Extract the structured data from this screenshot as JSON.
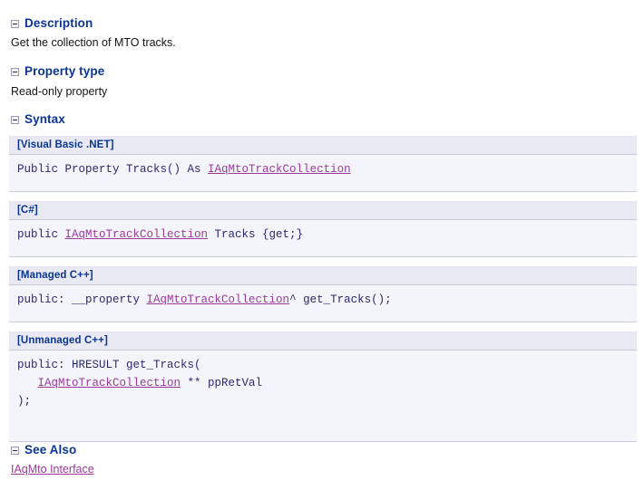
{
  "sections": {
    "description": {
      "heading": "Description",
      "toggle_icon": "collapse-minus-icon",
      "text": "Get the collection of MTO tracks."
    },
    "property_type": {
      "heading": "Property type",
      "toggle_icon": "collapse-minus-icon",
      "text": "Read-only property"
    },
    "syntax": {
      "heading": "Syntax",
      "toggle_icon": "collapse-minus-icon",
      "blocks": [
        {
          "language": "[Visual Basic .NET]",
          "code_before": "Public Property Tracks() As ",
          "link": "IAqMtoTrackCollection",
          "code_after": ""
        },
        {
          "language": "[C#]",
          "code_before": "public ",
          "link": "IAqMtoTrackCollection",
          "code_after": " Tracks {get;}"
        },
        {
          "language": "[Managed C++]",
          "code_before": "public: __property ",
          "link": "IAqMtoTrackCollection",
          "code_after": "^ get_Tracks();"
        },
        {
          "language": "[Unmanaged C++]",
          "code_before": "public: HRESULT get_Tracks(\n   ",
          "link": "IAqMtoTrackCollection",
          "code_after": " ** ppRetVal\n);"
        }
      ]
    },
    "see_also": {
      "heading": "See Also",
      "toggle_icon": "collapse-minus-icon",
      "links": [
        {
          "label": "IAqMto Interface"
        }
      ]
    }
  },
  "colors": {
    "heading": "#0a3596",
    "link": "#9c3a9c",
    "code_text": "#2a2a6e",
    "lang_bar_bg": "#e9e9f3",
    "code_bg": "#f4f4fb",
    "border": "#c9c9dc",
    "page_bg": "#ffffff"
  }
}
